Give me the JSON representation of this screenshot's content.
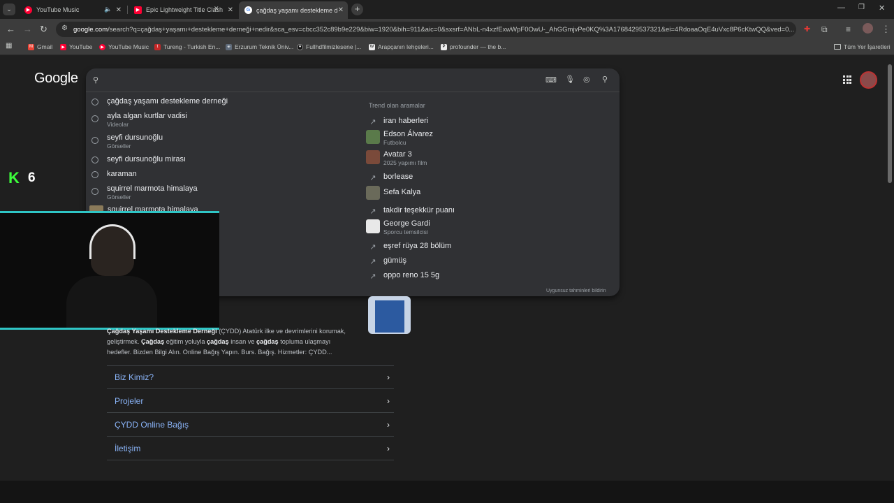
{
  "tabs": [
    {
      "label": "YouTube Music",
      "favicon_color": "#ff0033",
      "active": false
    },
    {
      "label": "Epic Lightweight Title Clash",
      "favicon_color": "#ff0033",
      "active": false
    },
    {
      "label": "çağdaş yaşamı destekleme der",
      "favicon_color": "#4285f4",
      "active": true
    }
  ],
  "omnibox": {
    "host": "google.com",
    "path": "/search?q=çağdaş+yaşamı+destekleme+derneği+nedir&sca_esv=cbcc352c89b9e229&biw=1920&bih=911&aic=0&sxsrf=ANbL-n4xzfExwWpF0OwU-_AhGGmjvPe0KQ%3A1768429537321&ei=4RdoaaOqE4uVxc8P6cKtwQQ&ved=0..."
  },
  "bookmarks": [
    {
      "label": "Gmail",
      "icon_color": "#ea4335"
    },
    {
      "label": "YouTube",
      "icon_color": "#ff0033"
    },
    {
      "label": "YouTube Music",
      "icon_color": "#ff0033"
    },
    {
      "label": "Tureng - Turkish En...",
      "icon_color": "#c62828"
    },
    {
      "label": "Erzurum Teknik Üniv...",
      "icon_color": "#9aa0a6"
    },
    {
      "label": "Fullhdfilmizlesene |...",
      "icon_color": "#222222"
    },
    {
      "label": "Arapçanın lehçeleri...",
      "icon_color": "#eeeeee"
    },
    {
      "label": "profounder — the b...",
      "icon_color": "#eeeeee"
    }
  ],
  "bookmarks_all": "Tüm Yer İşaretleri",
  "google_logo": "Google",
  "history": [
    {
      "text": "çağdaş yaşamı destekleme derneği",
      "sub": ""
    },
    {
      "text": "ayla algan kurtlar vadisi",
      "sub": "Videolar"
    },
    {
      "text": "seyfi dursunoğlu",
      "sub": "Görseller"
    },
    {
      "text": "seyfi dursunoğlu mirası",
      "sub": ""
    },
    {
      "text": "karaman",
      "sub": ""
    },
    {
      "text": "squirrel marmota himalaya",
      "sub": "Görseller"
    },
    {
      "text": "squirrel marmota himalaya",
      "sub": ""
    }
  ],
  "trending_title": "Trend olan aramalar",
  "trending": [
    {
      "text": "iran haberleri",
      "sub": "",
      "icon": "trending-icon"
    },
    {
      "text": "Edson Álvarez",
      "sub": "Futbolcu",
      "icon": "thumbnail"
    },
    {
      "text": "Avatar 3",
      "sub": "2025 yapımı film",
      "icon": "thumbnail"
    },
    {
      "text": "borlease",
      "sub": "",
      "icon": "trending-icon"
    },
    {
      "text": "Sefa Kalya",
      "sub": "",
      "icon": "thumbnail"
    },
    {
      "text": "takdir teşekkür puanı",
      "sub": "",
      "icon": "trending-icon"
    },
    {
      "text": "George Gardi",
      "sub": "Sporcu temsilcisi",
      "icon": "thumbnail"
    },
    {
      "text": "eşref rüya 28 bölüm",
      "sub": "",
      "icon": "trending-icon"
    },
    {
      "text": "gümüş",
      "sub": "",
      "icon": "trending-icon"
    },
    {
      "text": "oppo reno 15 5g",
      "sub": "",
      "icon": "trending-icon"
    }
  ],
  "feedback": "Uygunsuz tahminleri bildirin",
  "overlay": {
    "k_letter": "K",
    "k_number": "6"
  },
  "snippet": {
    "bold1": "Çağdaş Yaşamı Destekleme Derneği",
    "part1": " (ÇYDD) Atatürk ilke ve devrimlerini korumak,",
    "part2": "geliştirmek. ",
    "bold2": "Çağdaş",
    "part3": " eğitim yoluyla ",
    "bold3": "çağdaş",
    "part4": " insan ve ",
    "bold4": "çağdaş",
    "part5": " topluma ulaşmayı",
    "part6": "hedefler. Bizden Bilgi Alın. Online Bağış Yapın. Burs. Bağış. Hizmetler: ÇYDD..."
  },
  "sitelinks": [
    "Biz Kimiz?",
    "Projeler",
    "ÇYDD Online Bağış",
    "İletişim"
  ]
}
